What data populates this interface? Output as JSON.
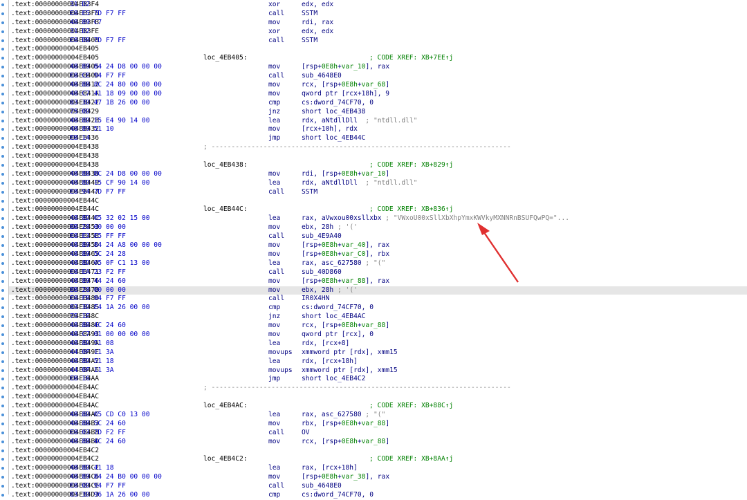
{
  "accent": "#e03030",
  "arrow_icon": "red-arrow-annotation",
  "rows": [
    {
      "a": ".text:00000000004EB3F4",
      "b": "31 D2",
      "m": "xor",
      "o": [
        [
          "edx, edx",
          ""
        ]
      ]
    },
    {
      "a": ".text:00000000004EB3F6",
      "b": "E8 E5 7D F7 FF",
      "m": "call",
      "o": [
        [
          "SSTM",
          ""
        ]
      ]
    },
    {
      "a": ".text:00000000004EB3FB",
      "b": "48 89 C7",
      "m": "mov",
      "o": [
        [
          "rdi, rax",
          ""
        ]
      ]
    },
    {
      "a": ".text:00000000004EB3FE",
      "b": "31 D2",
      "m": "xor",
      "o": [
        [
          "edx, edx",
          ""
        ]
      ]
    },
    {
      "a": ".text:00000000004EB400",
      "b": "E8 DB 7D F7 FF",
      "m": "call",
      "o": [
        [
          "SSTM",
          ""
        ]
      ]
    },
    {
      "a": ".text:00000000004EB405"
    },
    {
      "a": ".text:00000000004EB405",
      "l": "loc_4EB405:",
      "c": "; CODE XREF: XB+7EE↑j"
    },
    {
      "a": ".text:00000000004EB405",
      "b": "48 89 84 24 D8 00 00 00",
      "m": "mov",
      "o": [
        [
          "[rsp+",
          ""
        ],
        [
          "0E8h",
          "hex"
        ],
        [
          "+",
          ""
        ],
        [
          "var_10",
          "var"
        ],
        [
          "], rax",
          ""
        ]
      ]
    },
    {
      "a": ".text:00000000004EB40D",
      "b": "E8 CE 94 F7 FF",
      "m": "call",
      "o": [
        [
          "sub_4648E0",
          ""
        ]
      ]
    },
    {
      "a": ".text:00000000004EB412",
      "b": "48 8B 8C 24 80 00 00 00",
      "m": "mov",
      "o": [
        [
          "rcx, [rsp+",
          ""
        ],
        [
          "0E8h",
          "hex"
        ],
        [
          "+",
          ""
        ],
        [
          "var_68",
          "var"
        ],
        [
          "]",
          ""
        ]
      ]
    },
    {
      "a": ".text:00000000004EB41A",
      "b": "48 C7 41 18 09 00 00 00",
      "m": "mov",
      "o": [
        [
          "qword ptr [rcx+18h], 9",
          ""
        ]
      ]
    },
    {
      "a": ".text:00000000004EB422",
      "b": "83 3D 47 1B 26 00 00",
      "m": "cmp",
      "o": [
        [
          "cs:dword_74CF70, 0",
          ""
        ]
      ]
    },
    {
      "a": ".text:00000000004EB429",
      "b": "75 0D",
      "m": "jnz",
      "o": [
        [
          "short loc_4EB438",
          ""
        ]
      ]
    },
    {
      "a": ".text:00000000004EB42B",
      "b": "48 8D 15 E4 90 14 00",
      "m": "lea",
      "o": [
        [
          "rdx, aNtdllDll",
          ""
        ],
        [
          "  ; \"ntdll.dll\"",
          "str"
        ]
      ]
    },
    {
      "a": ".text:00000000004EB432",
      "b": "48 89 51 10",
      "m": "mov",
      "o": [
        [
          "[rcx+10h], rdx",
          ""
        ]
      ]
    },
    {
      "a": ".text:00000000004EB436",
      "b": "EB 14",
      "m": "jmp",
      "o": [
        [
          "short loc_4EB44C",
          ""
        ]
      ]
    },
    {
      "a": ".text:00000000004EB438",
      "s": "; ---------------------------------------------------------------------------"
    },
    {
      "a": ".text:00000000004EB438"
    },
    {
      "a": ".text:00000000004EB438",
      "l": "loc_4EB438:",
      "c": "; CODE XREF: XB+829↑j"
    },
    {
      "a": ".text:00000000004EB438",
      "b": "48 8B BC 24 D8 00 00 00",
      "m": "mov",
      "o": [
        [
          "rdi, [rsp+",
          ""
        ],
        [
          "0E8h",
          "hex"
        ],
        [
          "+",
          ""
        ],
        [
          "var_10",
          "var"
        ],
        [
          "]",
          ""
        ]
      ]
    },
    {
      "a": ".text:00000000004EB440",
      "b": "48 8D 15 CF 90 14 00",
      "m": "lea",
      "o": [
        [
          "rdx, aNtdllDll",
          ""
        ],
        [
          "  ; \"ntdll.dll\"",
          "str"
        ]
      ]
    },
    {
      "a": ".text:00000000004EB447",
      "b": "E8 94 7D F7 FF",
      "m": "call",
      "o": [
        [
          "SSTM",
          ""
        ]
      ]
    },
    {
      "a": ".text:00000000004EB44C"
    },
    {
      "a": ".text:00000000004EB44C",
      "l": "loc_4EB44C:",
      "c": "; CODE XREF: XB+836↑j"
    },
    {
      "a": ".text:00000000004EB44C",
      "b": "48 8D 05 32 02 15 00",
      "m": "lea",
      "o": [
        [
          "rax, aVwxou00xsllxbx",
          ""
        ],
        [
          " ; \"VWxoU00xSllXbXhpYmxKWVkyMXNNRnBSUFQwPQ=\"...",
          "str"
        ]
      ]
    },
    {
      "a": ".text:00000000004EB453",
      "b": "BB 28 00 00 00",
      "m": "mov",
      "o": [
        [
          "ebx, 28h",
          ""
        ],
        [
          " ; '('",
          "str"
        ]
      ]
    },
    {
      "a": ".text:00000000004EB458",
      "b": "E8 E3 E5 FF FF",
      "m": "call",
      "o": [
        [
          "sub_4E9A40",
          ""
        ]
      ]
    },
    {
      "a": ".text:00000000004EB45D",
      "b": "48 89 84 24 A8 00 00 00",
      "m": "mov",
      "o": [
        [
          "[rsp+",
          ""
        ],
        [
          "0E8h",
          "hex"
        ],
        [
          "+",
          ""
        ],
        [
          "var_40",
          "var"
        ],
        [
          "], rax",
          ""
        ]
      ]
    },
    {
      "a": ".text:00000000004EB465",
      "b": "48 89 5C 24 28",
      "m": "mov",
      "o": [
        [
          "[rsp+",
          ""
        ],
        [
          "0E8h",
          "hex"
        ],
        [
          "+",
          ""
        ],
        [
          "var_C0",
          "var"
        ],
        [
          "], rbx",
          ""
        ]
      ]
    },
    {
      "a": ".text:00000000004EB46A",
      "b": "48 8D 05 0F C1 13 00",
      "m": "lea",
      "o": [
        [
          "rax, asc_627580",
          ""
        ],
        [
          " ; \"(\"",
          "str"
        ]
      ]
    },
    {
      "a": ".text:00000000004EB471",
      "b": "E8 EA 23 F2 FF",
      "m": "call",
      "o": [
        [
          "sub_40D860",
          ""
        ]
      ]
    },
    {
      "a": ".text:00000000004EB476",
      "b": "48 89 44 24 60",
      "m": "mov",
      "o": [
        [
          "[rsp+",
          ""
        ],
        [
          "0E8h",
          "hex"
        ],
        [
          "+",
          ""
        ],
        [
          "var_88",
          "var"
        ],
        [
          "], rax",
          ""
        ]
      ]
    },
    {
      "a": ".text:00000000004EB47B",
      "b": "BB 28 00 00 00",
      "m": "mov",
      "o": [
        [
          "ebx, 28h",
          ""
        ],
        [
          " ; '('",
          "str"
        ]
      ],
      "hl": true
    },
    {
      "a": ".text:00000000004EB480",
      "b": "E8 FB 94 F7 FF",
      "m": "call",
      "o": [
        [
          "IR0X4HN",
          ""
        ]
      ]
    },
    {
      "a": ".text:00000000004EB485",
      "b": "83 3D E4 1A 26 00 00",
      "m": "cmp",
      "o": [
        [
          "cs:dword_74CF70, 0",
          ""
        ]
      ]
    },
    {
      "a": ".text:00000000004EB48C",
      "b": "75 1E",
      "m": "jnz",
      "o": [
        [
          "short loc_4EB4AC",
          ""
        ]
      ]
    },
    {
      "a": ".text:00000000004EB48E",
      "b": "48 8B 4C 24 60",
      "m": "mov",
      "o": [
        [
          "rcx, [rsp+",
          ""
        ],
        [
          "0E8h",
          "hex"
        ],
        [
          "+",
          ""
        ],
        [
          "var_88",
          "var"
        ],
        [
          "]",
          ""
        ]
      ]
    },
    {
      "a": ".text:00000000004EB493",
      "b": "48 C7 01 00 00 00 00",
      "m": "mov",
      "o": [
        [
          "qword ptr [rcx], 0",
          ""
        ]
      ]
    },
    {
      "a": ".text:00000000004EB49A",
      "b": "48 8D 51 08",
      "m": "lea",
      "o": [
        [
          "rdx, [rcx+8]",
          ""
        ]
      ]
    },
    {
      "a": ".text:00000000004EB49E",
      "b": "44 0F 11 3A",
      "m": "movups",
      "o": [
        [
          "xmmword ptr [rdx], xmm15",
          ""
        ]
      ]
    },
    {
      "a": ".text:00000000004EB4A2",
      "b": "48 8D 51 18",
      "m": "lea",
      "o": [
        [
          "rdx, [rcx+18h]",
          ""
        ]
      ]
    },
    {
      "a": ".text:00000000004EB4A6",
      "b": "44 0F 11 3A",
      "m": "movups",
      "o": [
        [
          "xmmword ptr [rdx], xmm15",
          ""
        ]
      ]
    },
    {
      "a": ".text:00000000004EB4AA",
      "b": "EB 16",
      "m": "jmp",
      "o": [
        [
          "short loc_4EB4C2",
          ""
        ]
      ]
    },
    {
      "a": ".text:00000000004EB4AC",
      "s": "; ---------------------------------------------------------------------------"
    },
    {
      "a": ".text:00000000004EB4AC"
    },
    {
      "a": ".text:00000000004EB4AC",
      "l": "loc_4EB4AC:",
      "c": "; CODE XREF: XB+88C↑j"
    },
    {
      "a": ".text:00000000004EB4AC",
      "b": "48 8D 05 CD C0 13 00",
      "m": "lea",
      "o": [
        [
          "rax, asc_627580",
          ""
        ],
        [
          " ; \"(\"",
          "str"
        ]
      ]
    },
    {
      "a": ".text:00000000004EB4B3",
      "b": "48 8B 5C 24 60",
      "m": "mov",
      "o": [
        [
          "rbx, [rsp+",
          ""
        ],
        [
          "0E8h",
          "hex"
        ],
        [
          "+",
          ""
        ],
        [
          "var_88",
          "var"
        ],
        [
          "]",
          ""
        ]
      ]
    },
    {
      "a": ".text:00000000004EB4B8",
      "b": "E8 03 7D F2 FF",
      "m": "call",
      "o": [
        [
          "OV",
          ""
        ]
      ]
    },
    {
      "a": ".text:00000000004EB4BD",
      "b": "48 8B 4C 24 60",
      "m": "mov",
      "o": [
        [
          "rcx, [rsp+",
          ""
        ],
        [
          "0E8h",
          "hex"
        ],
        [
          "+",
          ""
        ],
        [
          "var_88",
          "var"
        ],
        [
          "]",
          ""
        ]
      ]
    },
    {
      "a": ".text:00000000004EB4C2"
    },
    {
      "a": ".text:00000000004EB4C2",
      "l": "loc_4EB4C2:",
      "c": "; CODE XREF: XB+8AA↑j"
    },
    {
      "a": ".text:00000000004EB4C2",
      "b": "48 8D 41 18",
      "m": "lea",
      "o": [
        [
          "rax, [rcx+18h]",
          ""
        ]
      ]
    },
    {
      "a": ".text:00000000004EB4C6",
      "b": "48 89 84 24 B0 00 00 00",
      "m": "mov",
      "o": [
        [
          "[rsp+",
          ""
        ],
        [
          "0E8h",
          "hex"
        ],
        [
          "+",
          ""
        ],
        [
          "var_38",
          "var"
        ],
        [
          "], rax",
          ""
        ]
      ]
    },
    {
      "a": ".text:00000000004EB4CE",
      "b": "E8 0D 94 F7 FF",
      "m": "call",
      "o": [
        [
          "sub_4648E0",
          ""
        ]
      ]
    },
    {
      "a": ".text:00000000004EB4D3",
      "b": "83 3D 96 1A 26 00 00",
      "m": "cmp",
      "o": [
        [
          "cs:dword_74CF70, 0",
          ""
        ]
      ]
    }
  ]
}
